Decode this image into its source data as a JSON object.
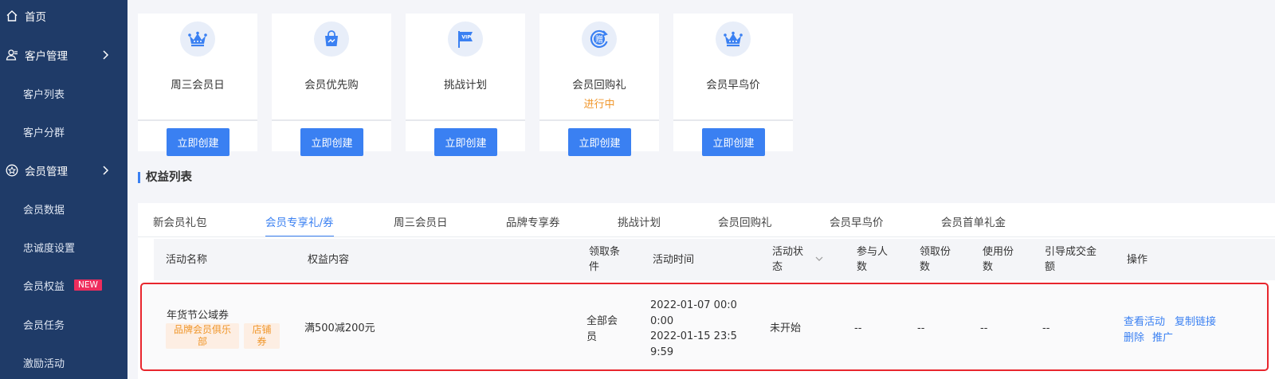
{
  "sidebar": {
    "items": [
      {
        "label": "首页",
        "type": "top",
        "icon": "home-icon"
      },
      {
        "label": "客户管理",
        "type": "top",
        "icon": "user-manage-icon",
        "expandable": true
      },
      {
        "label": "客户列表",
        "type": "sub"
      },
      {
        "label": "客户分群",
        "type": "sub"
      },
      {
        "label": "会员管理",
        "type": "top",
        "icon": "member-star-icon",
        "expandable": true
      },
      {
        "label": "会员数据",
        "type": "sub"
      },
      {
        "label": "忠诚度设置",
        "type": "sub"
      },
      {
        "label": "会员权益",
        "type": "sub",
        "badge": "NEW"
      },
      {
        "label": "会员任务",
        "type": "sub"
      },
      {
        "label": "激励活动",
        "type": "sub"
      }
    ]
  },
  "cards": [
    {
      "title": "周三会员日",
      "button": "立即创建",
      "icon": "crown-icon"
    },
    {
      "title": "会员优先购",
      "button": "立即创建",
      "icon": "shopping-bag-icon"
    },
    {
      "title": "挑战计划",
      "button": "立即创建",
      "icon": "vip-flag-icon"
    },
    {
      "title": "会员回购礼",
      "status": "进行中",
      "button": "立即创建",
      "icon": "gift-refresh-icon",
      "icon_text": "赠"
    },
    {
      "title": "会员早鸟价",
      "button": "立即创建",
      "icon": "crown-icon"
    }
  ],
  "section_title": "权益列表",
  "tabs": [
    {
      "label": "新会员礼包"
    },
    {
      "label": "会员专享礼/券",
      "active": true
    },
    {
      "label": "周三会员日"
    },
    {
      "label": "品牌专享券"
    },
    {
      "label": "挑战计划"
    },
    {
      "label": "会员回购礼"
    },
    {
      "label": "会员早鸟价"
    },
    {
      "label": "会员首单礼金"
    }
  ],
  "table": {
    "headers": {
      "name": "活动名称",
      "content": "权益内容",
      "condition_1": "领取条",
      "condition_2": "件",
      "time": "活动时间",
      "status_1": "活动状",
      "status_2": "态",
      "participants_1": "参与人",
      "participants_2": "数",
      "claimed_1": "领取份",
      "claimed_2": "数",
      "used_1": "使用份",
      "used_2": "数",
      "gmv_1": "引导成交金",
      "gmv_2": "额",
      "actions": "操作"
    },
    "rows": [
      {
        "name": "年货节公域券",
        "tag1_line1": "品牌会员俱乐",
        "tag1_line2": "部",
        "tag2_line1": "店铺",
        "tag2_line2": "券",
        "content": "满500减200元",
        "condition_1": "全部会",
        "condition_2": "员",
        "time_1": "2022-01-07 00:0",
        "time_2": "0:00",
        "time_3": "2022-01-15 23:5",
        "time_4": "9:59",
        "status": "未开始",
        "participants": "--",
        "claimed": "--",
        "used": "--",
        "gmv": "--",
        "actions": {
          "view": "查看活动",
          "copy": "复制链接",
          "delete": "删除",
          "promote": "推广"
        }
      }
    ]
  },
  "colors": {
    "sidebar_bg": "#1f3b68",
    "primary": "#3a80f2",
    "warning": "#f0962a",
    "badge": "#ee2d5d",
    "highlight_border": "#e8262d"
  }
}
